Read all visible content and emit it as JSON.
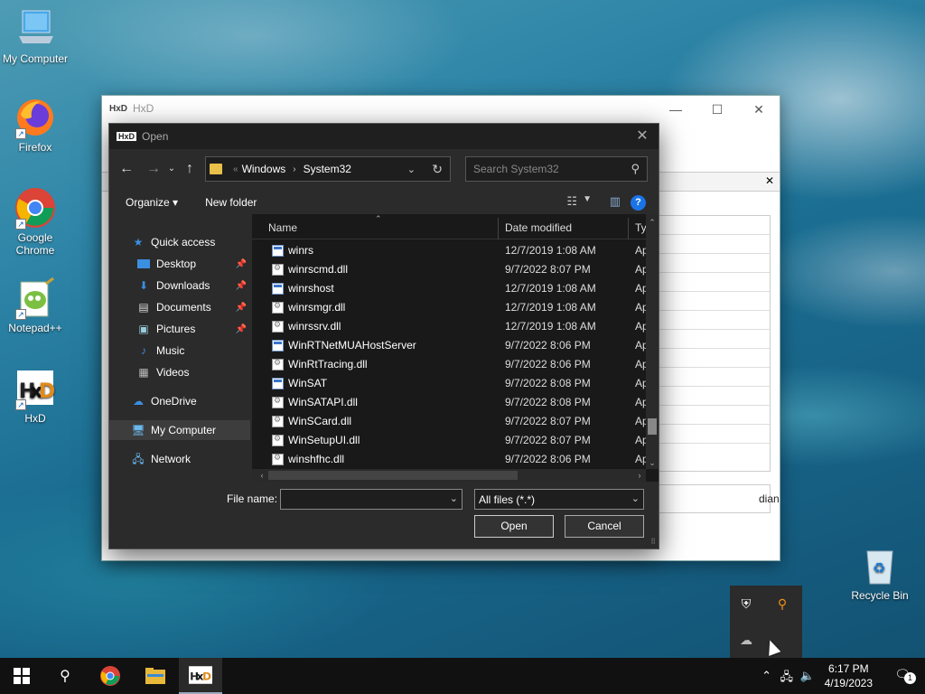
{
  "desktop": {
    "icons": [
      {
        "label": "My Computer"
      },
      {
        "label": "Firefox"
      },
      {
        "label": "Google Chrome"
      },
      {
        "label": "Notepad++"
      },
      {
        "label": "HxD"
      },
      {
        "label": "Recycle Bin"
      }
    ]
  },
  "hxd": {
    "title": "HxD",
    "endian_partial": "dian"
  },
  "dialog": {
    "title": "Open",
    "address": {
      "crumbs": [
        "Windows",
        "System32"
      ]
    },
    "search_placeholder": "Search System32",
    "toolbar": {
      "organize": "Organize ▾",
      "new_folder": "New folder"
    },
    "nav": {
      "quick_access": "Quick access",
      "desktop": "Desktop",
      "downloads": "Downloads",
      "documents": "Documents",
      "pictures": "Pictures",
      "music": "Music",
      "videos": "Videos",
      "onedrive": "OneDrive",
      "my_computer": "My Computer",
      "network": "Network"
    },
    "columns": {
      "name": "Name",
      "date": "Date modified",
      "type": "Ty"
    },
    "files": [
      {
        "name": "winrs",
        "date": "12/7/2019 1:08 AM",
        "type": "Ap",
        "kind": "exe"
      },
      {
        "name": "winrscmd.dll",
        "date": "9/7/2022 8:07 PM",
        "type": "Ap",
        "kind": "dll"
      },
      {
        "name": "winrshost",
        "date": "12/7/2019 1:08 AM",
        "type": "Ap",
        "kind": "exe"
      },
      {
        "name": "winrsmgr.dll",
        "date": "12/7/2019 1:08 AM",
        "type": "Ap",
        "kind": "dll"
      },
      {
        "name": "winrssrv.dll",
        "date": "12/7/2019 1:08 AM",
        "type": "Ap",
        "kind": "dll"
      },
      {
        "name": "WinRTNetMUAHostServer",
        "date": "9/7/2022 8:06 PM",
        "type": "Ap",
        "kind": "exe"
      },
      {
        "name": "WinRtTracing.dll",
        "date": "9/7/2022 8:06 PM",
        "type": "Ap",
        "kind": "dll"
      },
      {
        "name": "WinSAT",
        "date": "9/7/2022 8:08 PM",
        "type": "Ap",
        "kind": "exe"
      },
      {
        "name": "WinSATAPI.dll",
        "date": "9/7/2022 8:08 PM",
        "type": "Ap",
        "kind": "dll"
      },
      {
        "name": "WinSCard.dll",
        "date": "9/7/2022 8:07 PM",
        "type": "Ap",
        "kind": "dll"
      },
      {
        "name": "WinSetupUI.dll",
        "date": "9/7/2022 8:07 PM",
        "type": "Ap",
        "kind": "dll"
      },
      {
        "name": "winshfhc.dll",
        "date": "9/7/2022 8:06 PM",
        "type": "Ap",
        "kind": "dll"
      }
    ],
    "file_name_label": "File name:",
    "file_name_value": "",
    "file_type": "All files (*.*)",
    "open_label": "Open",
    "cancel_label": "Cancel"
  },
  "taskbar": {
    "time": "6:17 PM",
    "date": "4/19/2023",
    "notification_count": "1"
  },
  "colors": {
    "dialog_bg": "#2b2b2b",
    "file_list_bg": "#191919",
    "taskbar_bg": "#111111",
    "accent": "#1a73e8"
  }
}
